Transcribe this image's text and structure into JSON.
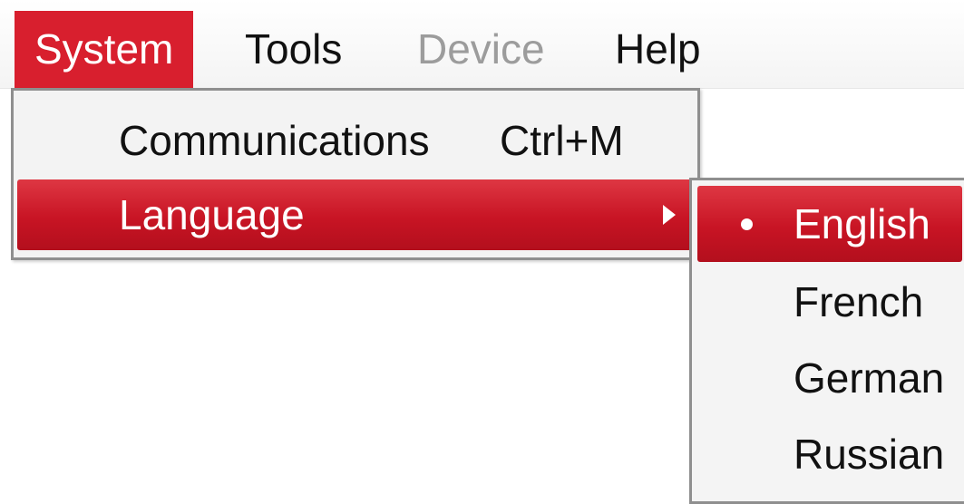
{
  "menubar": {
    "items": [
      {
        "label": "System",
        "state": "active"
      },
      {
        "label": "Tools",
        "state": "normal"
      },
      {
        "label": "Device",
        "state": "disabled"
      },
      {
        "label": "Help",
        "state": "normal"
      }
    ]
  },
  "system_menu": {
    "items": [
      {
        "label": "Communications",
        "shortcut": "Ctrl+M",
        "icon": ""
      },
      {
        "label": "Language",
        "shortcut": "",
        "icon": "submenu-arrow-icon"
      }
    ]
  },
  "language_menu": {
    "items": [
      {
        "label": "English",
        "selected": true,
        "icon": "bullet-icon"
      },
      {
        "label": "French",
        "selected": false
      },
      {
        "label": "German",
        "selected": false
      },
      {
        "label": "Russian",
        "selected": false
      }
    ]
  },
  "colors": {
    "accent": "#d81f2e",
    "disabled_text": "#9c9c9c",
    "menu_background": "#f3f3f3",
    "border": "#8f8f8f"
  }
}
